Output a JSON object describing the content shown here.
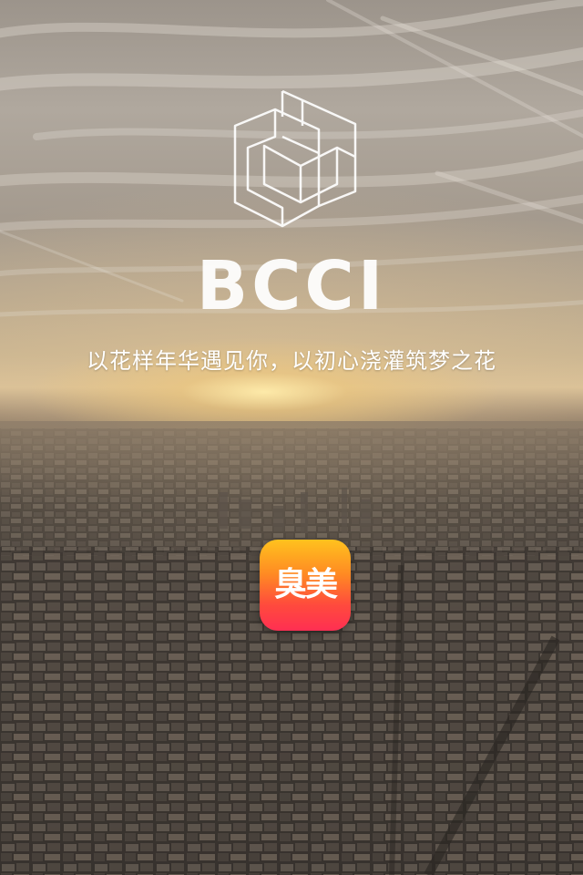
{
  "splash": {
    "brand": "BCCI",
    "slogan": "以花样年华遇见你，以初心浇灌筑梦之花",
    "logo_icon": "cube-outline-logo-icon",
    "app_icon": {
      "label": "臭美",
      "icon": "app-icon",
      "gradient": [
        "#ffc21e",
        "#ff8a23",
        "#ff4a3d",
        "#ff2f52"
      ]
    },
    "background": "sepia-city-sunset"
  }
}
